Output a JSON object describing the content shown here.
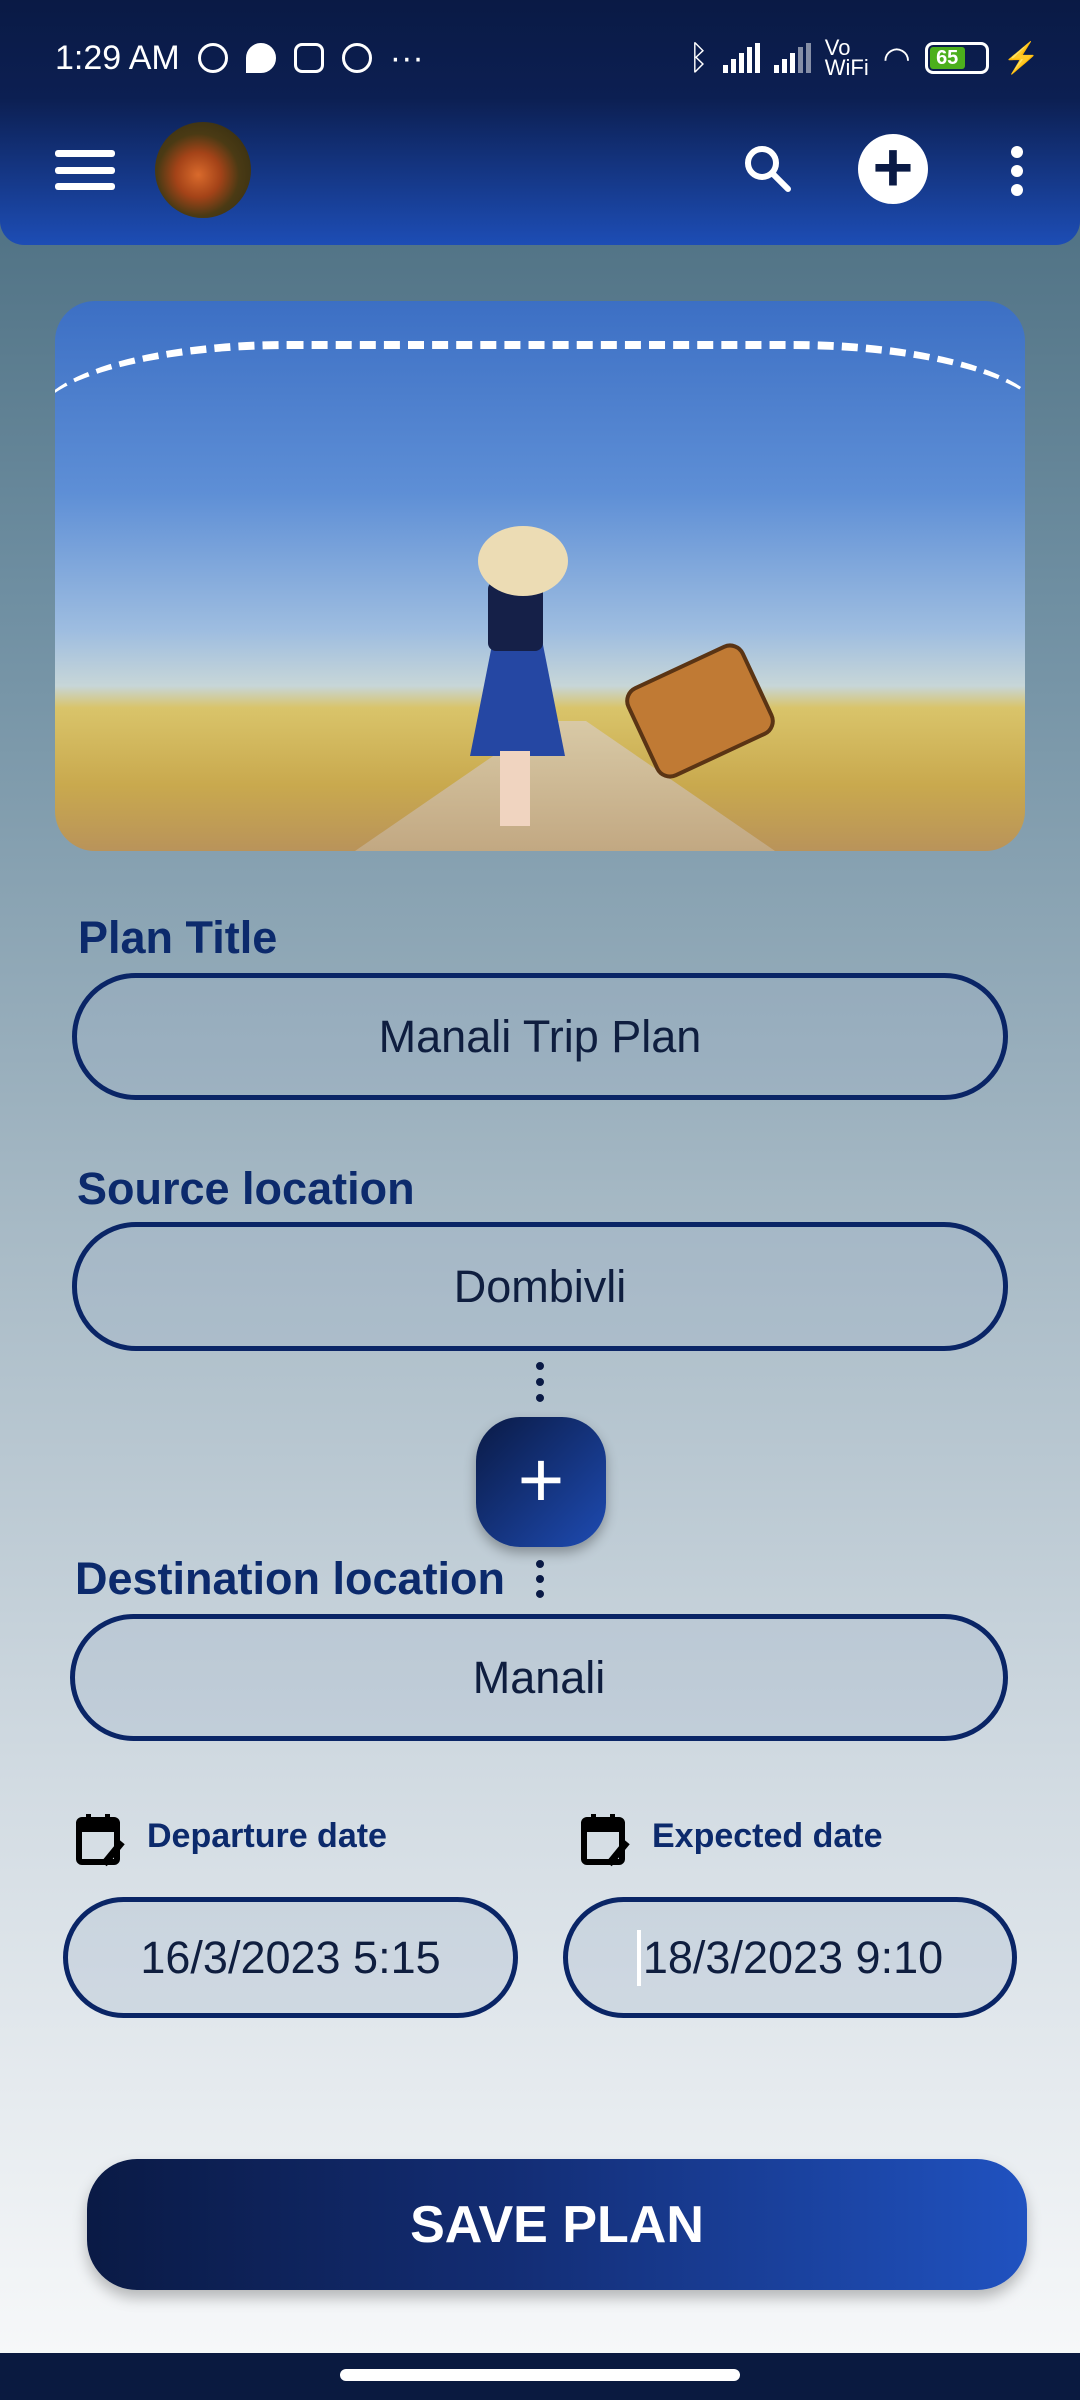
{
  "status_bar": {
    "time": "1:29 AM",
    "battery": "65",
    "vowifi_top": "Vo",
    "vowifi_bottom": "WiFi",
    "more": "···"
  },
  "form": {
    "plan_title_label": "Plan Title",
    "plan_title_value": "Manali Trip Plan",
    "source_label": "Source location",
    "source_value": "Dombivli",
    "destination_label": "Destination location",
    "destination_value": "Manali",
    "departure_label": "Departure date",
    "departure_value": "16/3/2023 5:15",
    "expected_label": "Expected date",
    "expected_value": "18/3/2023 9:10",
    "swap_symbol": "+"
  },
  "save_label": "SAVE PLAN",
  "colors": {
    "primary": "#0a1a45",
    "accent": "#2052c0",
    "border": "#0a2566"
  }
}
